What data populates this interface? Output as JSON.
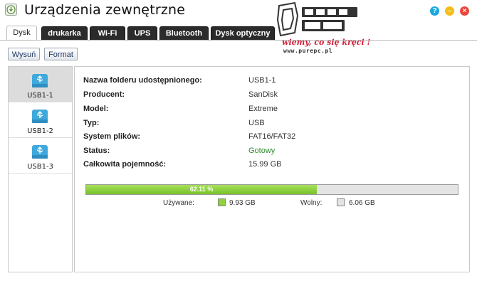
{
  "window": {
    "title": "Urządzenia zewnętrzne"
  },
  "watermark": {
    "slogan": "wiemy, co się kręci !",
    "url": "www.purepc.pl"
  },
  "tabs": [
    {
      "label": "Dysk",
      "active": true
    },
    {
      "label": "drukarka",
      "active": false
    },
    {
      "label": "Wi-Fi",
      "active": false
    },
    {
      "label": "UPS",
      "active": false
    },
    {
      "label": "Bluetooth",
      "active": false
    },
    {
      "label": "Dysk optyczny",
      "active": false
    }
  ],
  "toolbar": {
    "eject_label": "Wysuń",
    "format_label": "Format"
  },
  "devices": [
    {
      "label": "USB1-1",
      "selected": true,
      "icon": "usb-drive-icon"
    },
    {
      "label": "USB1-2",
      "selected": false,
      "icon": "usb-drive-icon"
    },
    {
      "label": "USB1-3",
      "selected": false,
      "icon": "usb-drive-icon"
    }
  ],
  "details": [
    {
      "label": "Nazwa folderu udostępnionego:",
      "value": "USB1-1"
    },
    {
      "label": "Producent:",
      "value": "SanDisk"
    },
    {
      "label": "Model:",
      "value": "Extreme"
    },
    {
      "label": "Typ:",
      "value": "USB"
    },
    {
      "label": "System plików:",
      "value": "FAT16/FAT32"
    },
    {
      "label": "Status:",
      "value": "Gotowy"
    },
    {
      "label": "Całkowita pojemność:",
      "value": "15.99 GB"
    }
  ],
  "usage": {
    "percent_text": "62.11 %",
    "used_fraction": 0.6211,
    "used_label": "Używane:",
    "used_value": "9.93 GB",
    "free_label": "Wolny:",
    "free_value": "6.06 GB"
  },
  "colors": {
    "used": "#8fd13f",
    "free": "#e4e4e4",
    "status_ok": "#2e8b2e",
    "usb_icon": "#3fa9dc"
  }
}
